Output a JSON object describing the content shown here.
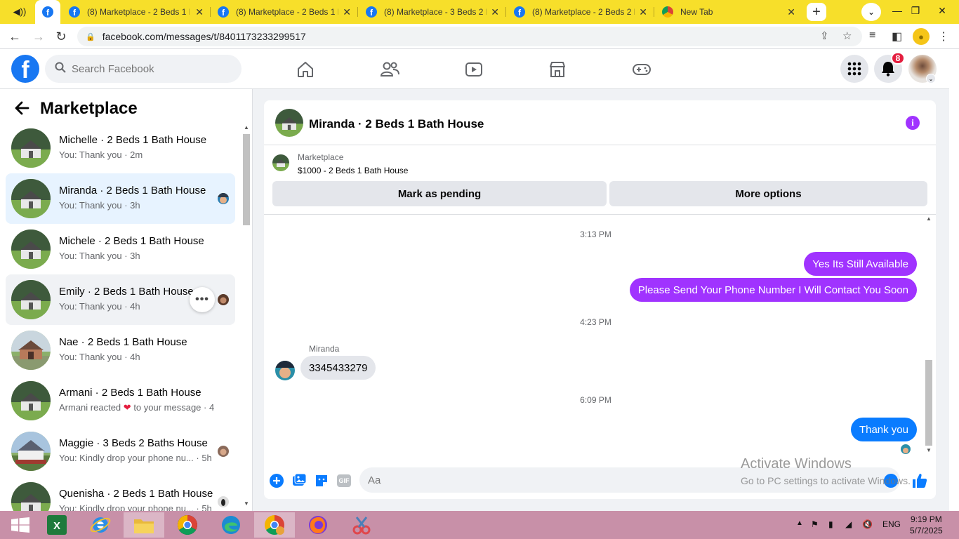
{
  "browser": {
    "tabs": [
      {
        "title": "(8) Marketplace - 2 Beds 1 B"
      },
      {
        "title": "(8) Marketplace - 2 Beds 1 B"
      },
      {
        "title": "(8) Marketplace - 3 Beds 2 B"
      },
      {
        "title": "(8) Marketplace - 2 Beds 2 B"
      },
      {
        "title": "New Tab"
      }
    ],
    "url": "facebook.com/messages/t/8401173233299517"
  },
  "fb": {
    "search_placeholder": "Search Facebook",
    "notification_count": "8"
  },
  "marketplace": {
    "title": "Marketplace",
    "conversations": [
      {
        "name": "Michelle · 2 Beds 1 Bath House",
        "preview": "You: Thank you · 2m"
      },
      {
        "name": "Miranda · 2 Beds 1 Bath House",
        "preview": "You: Thank you · 3h"
      },
      {
        "name": "Michele · 2 Beds 1 Bath House",
        "preview": "You: Thank you · 3h"
      },
      {
        "name": "Emily · 2 Beds 1 Bath House",
        "preview": "You: Thank you · 4h"
      },
      {
        "name": "Nae · 2 Beds 1 Bath House",
        "preview": "You: Thank you · 4h"
      },
      {
        "name": "Armani · 2 Beds 1 Bath House",
        "preview_a": "Armani reacted",
        "preview_b": "to your message · 4"
      },
      {
        "name": "Maggie · 3 Beds 2 Baths House",
        "preview": "You: Kindly drop your phone nu... · 5h"
      },
      {
        "name": "Quenisha · 2 Beds 1 Bath House",
        "preview": "You: Kindly drop your phone nu... · 5h"
      }
    ]
  },
  "chat": {
    "title": "Miranda · 2 Beds 1 Bath House",
    "listing_label": "Marketplace",
    "listing_price": "$1000 - 2 Beds 1 Bath House",
    "mark_pending": "Mark as pending",
    "more_options": "More options",
    "messages": {
      "ts1": "3:13 PM",
      "out1": "Yes Its Still Available",
      "out2": "Please Send Your Phone Number I Will Contact You Soon",
      "ts2": "4:23 PM",
      "sender": "Miranda",
      "in1": "3345433279",
      "ts3": "6:09 PM",
      "out3": "Thank you"
    },
    "input_placeholder": "Aa",
    "gif_label": "GIF"
  },
  "watermark": {
    "line1": "Activate Windows",
    "line2": "Go to PC settings to activate Windows."
  },
  "taskbar": {
    "lang": "ENG",
    "time": "9:19 PM",
    "date": "5/7/2025"
  }
}
